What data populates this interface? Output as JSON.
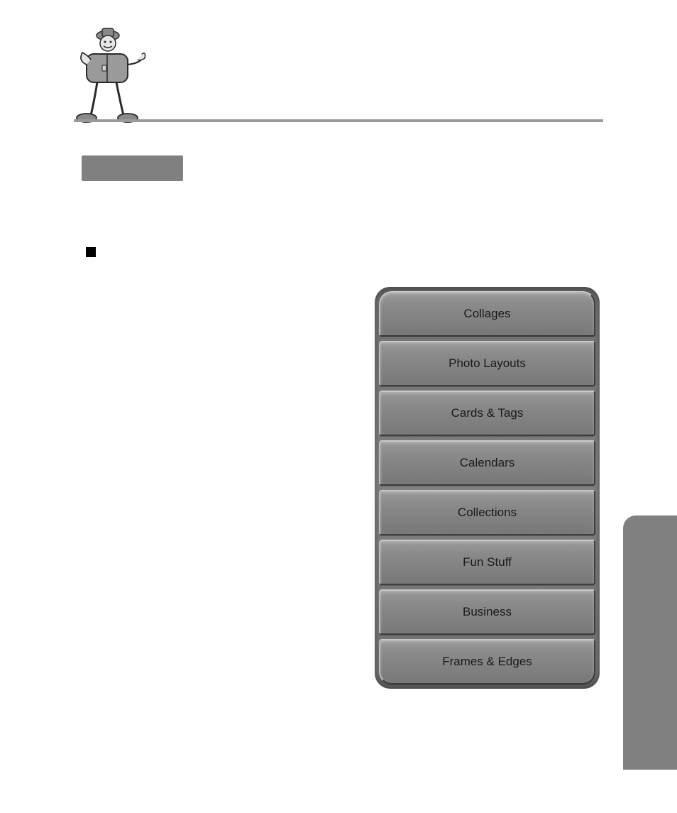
{
  "header": {
    "mascot_alt": "cartoon character holding box"
  },
  "buttons": [
    {
      "label": "Collages"
    },
    {
      "label": "Photo Layouts"
    },
    {
      "label": "Cards & Tags"
    },
    {
      "label": "Calendars"
    },
    {
      "label": "Collections"
    },
    {
      "label": "Fun Stuff"
    },
    {
      "label": "Business"
    },
    {
      "label": "Frames & Edges"
    }
  ]
}
